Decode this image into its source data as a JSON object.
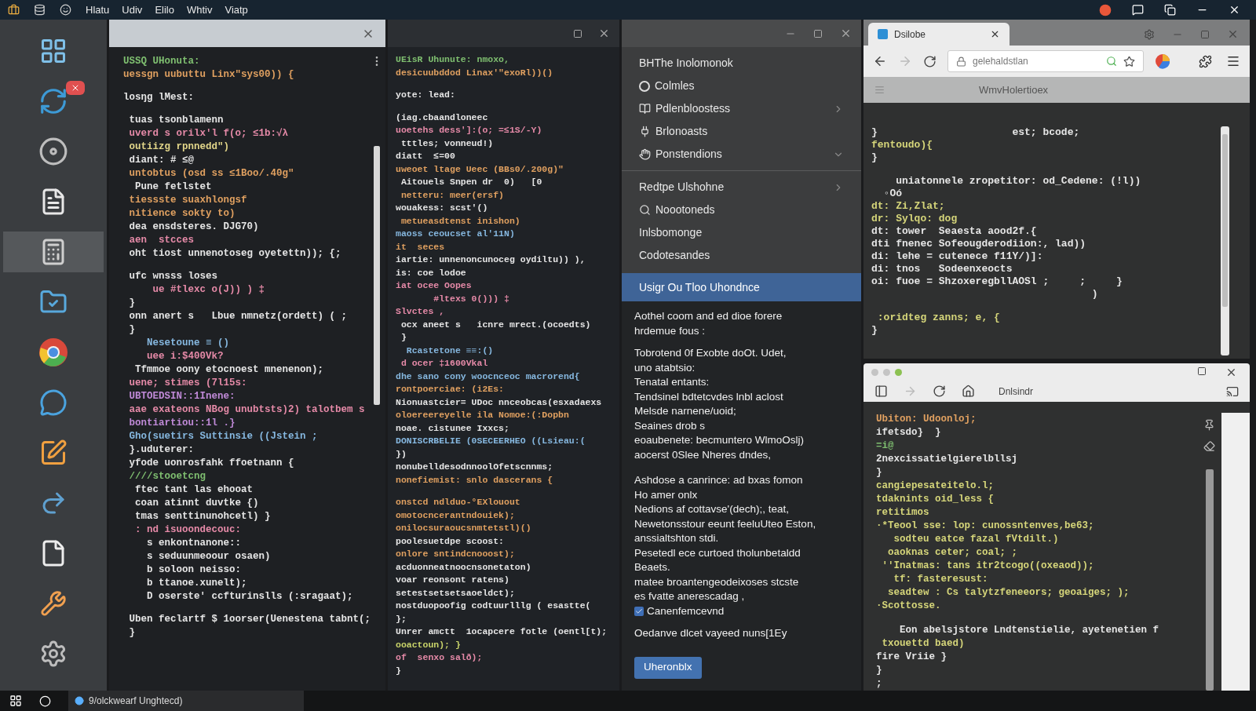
{
  "top_bar": {
    "menu": [
      "Hlatu",
      "Udiv",
      "Elilo",
      "Whtiv",
      "Viatp"
    ]
  },
  "dock": {
    "items": [
      {
        "kind": "panels",
        "selected": false,
        "alert": false
      },
      {
        "kind": "sync",
        "selected": false,
        "alert": true
      },
      {
        "kind": "disc",
        "selected": false,
        "alert": false
      },
      {
        "kind": "document",
        "selected": false,
        "alert": false
      },
      {
        "kind": "calculator",
        "selected": true,
        "alert": false
      },
      {
        "kind": "folder",
        "selected": false,
        "alert": false
      },
      {
        "kind": "browser",
        "selected": false,
        "alert": false
      },
      {
        "kind": "chat",
        "selected": false,
        "alert": false
      },
      {
        "kind": "editor",
        "selected": false,
        "alert": false
      },
      {
        "kind": "share",
        "selected": false,
        "alert": false
      },
      {
        "kind": "file",
        "selected": false,
        "alert": false
      },
      {
        "kind": "tool",
        "selected": false,
        "alert": false
      },
      {
        "kind": "settings",
        "selected": false,
        "alert": false
      }
    ]
  },
  "editor_left": {
    "blocks": [
      [
        {
          "text": "USSQ UHonuta:",
          "color": "#7fbf70"
        },
        {
          "text": "uessgn uubuttu Linx\"sys00)) {",
          "color": "#e0a060"
        }
      ],
      [
        {
          "text": "losŋg lMest:",
          "color": "#e6e6e6"
        }
      ],
      [
        {
          "text": " tuas tsonblamenn",
          "color": "#e6e6e6"
        },
        {
          "text": " uverd s orilx'l f(o; ≤1b:√λ",
          "color": "#e68aa8"
        },
        {
          "text": " outiizg rpnnedd\")",
          "color": "#e2d68a"
        },
        {
          "text": " diant: # ≤@",
          "color": "#e6e6e6"
        },
        {
          "text": " untobtus (osd ss ≤1Boo/.40g\"",
          "color": "#e0a060"
        },
        {
          "text": "  Pune fetlstet",
          "color": "#e6e6e6"
        },
        {
          "text": " tiessste suaxhlongsf",
          "color": "#e0a060"
        },
        {
          "text": " nitience sokty to)",
          "color": "#e0a060"
        },
        {
          "text": " dea ensdsteres. DJG70)",
          "color": "#e6e6e6"
        },
        {
          "text": " aen  stcces",
          "color": "#e68aa8"
        },
        {
          "text": " oht tiost unnenotoseg oyetettn)); {;",
          "color": "#e6e6e6"
        }
      ],
      [
        {
          "text": " ufc wnsss loses",
          "color": "#e6e6e6"
        },
        {
          "text": "     ue #tlexc o(J)) ) ‡",
          "color": "#e68aa8"
        },
        {
          "text": " }",
          "color": "#e6e6e6"
        },
        {
          "text": " onn anert s   Lbue nmnetz(ordett) ( ;",
          "color": "#e6e6e6"
        },
        {
          "text": " }",
          "color": "#e6e6e6"
        },
        {
          "text": "    Nesetoune ≡ ()",
          "color": "#86b8e0"
        },
        {
          "text": "    uee i:$400Vk?",
          "color": "#e68aa8"
        },
        {
          "text": "  Tfmmoe oony etocnoest mnenenon);",
          "color": "#e6e6e6"
        },
        {
          "text": " uene; stimes (7l15s:",
          "color": "#e68aa8"
        },
        {
          "text": " UBTOEDSIN::1Inene:",
          "color": "#c08ad8"
        },
        {
          "text": " aae exateons NBog unubtsts)2) talotbem s",
          "color": "#e68aa8"
        },
        {
          "text": " bontiartiou::1l .}",
          "color": "#c08ad8"
        },
        {
          "text": " Gho(suetirs Suttinsie ((Jstein ;",
          "color": "#86b8e0"
        },
        {
          "text": " }.uduterer:",
          "color": "#e6e6e6"
        },
        {
          "text": " yfode uonrosfahk ffoetnann {",
          "color": "#e6e6e6"
        },
        {
          "text": " ////stooetcng",
          "color": "#7fbf70"
        },
        {
          "text": "  ftec tant las ehooat",
          "color": "#e6e6e6"
        },
        {
          "text": "  coan atinnt duvtke {)",
          "color": "#e6e6e6"
        },
        {
          "text": "  tmas senttinunohcetl) }",
          "color": "#e6e6e6"
        },
        {
          "text": "  : nd isuoondecouc:",
          "color": "#e68aa8"
        },
        {
          "text": "    s enkontnanone::",
          "color": "#e6e6e6"
        },
        {
          "text": "    s seduunmeoour osaen)",
          "color": "#e6e6e6"
        },
        {
          "text": "    b soloon neisso:",
          "color": "#e6e6e6"
        },
        {
          "text": "    b ttanoe.xunelt);",
          "color": "#e6e6e6"
        },
        {
          "text": "    D oserste' ccfturinslls (:sragaat);",
          "color": "#e6e6e6"
        }
      ],
      [
        {
          "text": " Uben feclartf $ 1oorser(Uenestena tabnt(;",
          "color": "#e6e6e6"
        },
        {
          "text": " }",
          "color": "#e6e6e6"
        }
      ]
    ]
  },
  "editor_middle": {
    "blocks": [
      [
        {
          "text": "UEisR Uhunute: nmoxo,",
          "color": "#7fbf70"
        },
        {
          "text": "desicuubddod Linax'\"exoRl))()",
          "color": "#e0a060"
        }
      ],
      [
        {
          "text": "yote: lead:",
          "color": "#e6e6e6"
        }
      ],
      [
        {
          "text": "(iag.cbaandloneec",
          "color": "#e6e6e6"
        },
        {
          "text": "uoetehs dess']:(o; =≤1S/-Y)",
          "color": "#e68aa8"
        },
        {
          "text": " tttles; vonneud!)",
          "color": "#e6e6e6"
        },
        {
          "text": "diatt  ≤=00",
          "color": "#e6e6e6"
        },
        {
          "text": "uweoet ltage Ueec (BBs0/.200g)\"",
          "color": "#e0a060"
        },
        {
          "text": " Aitouels Snpen dr  0)   [0",
          "color": "#e6e6e6"
        },
        {
          "text": " netteru: meer(ersf)",
          "color": "#e0a060"
        },
        {
          "text": "wouakess: scst'()",
          "color": "#e6e6e6"
        },
        {
          "text": " metueasdtenst inishon)",
          "color": "#e0a060"
        },
        {
          "text": "maoss ceoucset al'11N)",
          "color": "#86b8e0"
        },
        {
          "text": "it  seces",
          "color": "#e0a060"
        },
        {
          "text": "iartie: unnenoncunoceg oydiltu)) ),",
          "color": "#e6e6e6"
        },
        {
          "text": "is: coe lodoe",
          "color": "#e6e6e6"
        },
        {
          "text": "iat ocee Oopes",
          "color": "#e68aa8"
        },
        {
          "text": "       #ltexs 0())) ‡",
          "color": "#e68aa8"
        },
        {
          "text": "Slvctes ,",
          "color": "#e68aa8"
        },
        {
          "text": " ocx aneet s   icnre mrect.(ocoedts)",
          "color": "#e6e6e6"
        },
        {
          "text": " }",
          "color": "#e6e6e6"
        },
        {
          "text": "  Rcastetone ≡≡:()",
          "color": "#86b8e0"
        },
        {
          "text": " d ocer ‡1600Vkal",
          "color": "#e68aa8"
        },
        {
          "text": "dhe sano cony woocnceoc macrorend{",
          "color": "#86b8e0"
        },
        {
          "text": "rontpoerciae: (i2Es:",
          "color": "#e0a060"
        },
        {
          "text": "Nionuastcier= UDoc nnceobcas(esxadaexs",
          "color": "#e6e6e6"
        },
        {
          "text": "oloereereyelle ila Nomoe:(:Dopbn",
          "color": "#e0a060"
        },
        {
          "text": "noae. cistunee Ixxcs;",
          "color": "#e6e6e6"
        },
        {
          "text": "DONISCRBELIE (0SECEERHEO ((Lsieau:(",
          "color": "#86b8e0"
        },
        {
          "text": "})",
          "color": "#e6e6e6"
        },
        {
          "text": "nonubelldesodnnoolOfetscnnms;",
          "color": "#e6e6e6"
        },
        {
          "text": "nonefiemist: snlo dascerans {",
          "color": "#e0a060"
        }
      ],
      [
        {
          "text": "onstcd ndlduo-°EXlouout",
          "color": "#e0a060"
        },
        {
          "text": "omotocncerantndouiek);",
          "color": "#e0a060"
        },
        {
          "text": "onilocsuraoucsnmtetstl)()",
          "color": "#e0a060"
        },
        {
          "text": "poolesuetdpe scoost:",
          "color": "#e6e6e6"
        },
        {
          "text": "onlore sntindcnooost);",
          "color": "#e0a060"
        },
        {
          "text": "acduonneatnoocnsonetaton)",
          "color": "#e6e6e6"
        },
        {
          "text": "voar reonsont ratens)",
          "color": "#e6e6e6"
        },
        {
          "text": "setestsetsetsaoeldct);",
          "color": "#e6e6e6"
        },
        {
          "text": "nostduopoofig codtuurlllg ( esastte(",
          "color": "#e6e6e6"
        },
        {
          "text": "};",
          "color": "#e6e6e6"
        },
        {
          "text": "Unrer amctt  1ocapcere fotle (oentl[t);",
          "color": "#e6e6e6"
        },
        {
          "text": "ooactoun); }",
          "color": "#c9d46a"
        },
        {
          "text": "of  senxo salð);",
          "color": "#e68aa8"
        },
        {
          "text": "}",
          "color": "#e6e6e6"
        }
      ]
    ]
  },
  "menu_panel": {
    "items": [
      {
        "kind": "plain",
        "label": "BHThe Inolomonok",
        "submenu": false,
        "selected": false
      },
      {
        "kind": "letter",
        "label": "Colmles",
        "submenu": false,
        "selected": false
      },
      {
        "kind": "book",
        "label": "Pdlenbloostess",
        "submenu": true,
        "expanded": false,
        "selected": false
      },
      {
        "kind": "plug",
        "label": "Brlonoasts",
        "submenu": false,
        "selected": false
      },
      {
        "kind": "hand",
        "label": "Ponstendions",
        "submenu": true,
        "expanded": true,
        "selected": false
      },
      {
        "kind": "divider"
      },
      {
        "kind": "plain",
        "label": "Redtpe Ulshohne",
        "submenu": true,
        "expanded": false,
        "selected": false
      },
      {
        "kind": "search",
        "label": "Noootoneds",
        "submenu": false,
        "selected": false
      },
      {
        "kind": "plain",
        "label": "Inlsbomonge",
        "submenu": false,
        "selected": false
      },
      {
        "kind": "plain",
        "label": "Codotesandes",
        "submenu": false,
        "selected": false
      },
      {
        "kind": "plain",
        "label": "Usigr Ou Tloo Uhondnce",
        "submenu": false,
        "selected": true
      }
    ],
    "notes": [
      [
        "Aothel coom and ed dioe forere",
        "hrdemue fous :"
      ],
      [
        "Tobrotend 0f Exobte doOt. Udet,",
        "uno atabtsio:",
        "Tenatal entants:",
        "Tendsinel bdtetcvdes lnbl aclost",
        "Melsde narnene/uoid;",
        "Seaines drob s",
        "eoaubenete: becmuntero WlmoOslj)",
        "aocerst 0Slee Nheres dndes,"
      ],
      [
        "Ashdose a canrince: ad bxas fomon",
        "Ho amer onlx",
        "Nedions af cottavse'(dech);, teat,",
        "Newetonsstour eeunt feeluUteo Eston,",
        "anssialtshton stdi.",
        "Pesetedl ece curtoed tholunbetaldd",
        "Beaets.",
        "matee broantengeodeixoses stcste",
        "es fvatte anerescadag ,"
      ]
    ],
    "checkbox": {
      "label": "Canenfemcevnd",
      "checked": true
    },
    "footer_note": "Oedanve dlcet vayeed nuns[1Ey",
    "button": "Uheronblx"
  },
  "browser_top": {
    "tab": "Dsilobe",
    "address": "gelehaldstlan",
    "forward_disabled": true,
    "page_title": "WmvHolertioex",
    "lines": [
      {
        "text": "}                      est; bcode;",
        "color": "#e6e6e6"
      },
      {
        "text": "fentoudo){",
        "color": "#d6d67a"
      },
      {
        "text": "}",
        "color": "#e6e6e6"
      },
      {
        "text": "    uniatonnele zropetitor: od_Cedene: (!l))",
        "color": "#e6e6e6"
      },
      {
        "text": "  ◦Oó",
        "color": "#e6e6e6"
      },
      {
        "text": "dt: Zi,Zlat;",
        "color": "#d6d67a"
      },
      {
        "text": "dr: Sylqo: dog",
        "color": "#d6d67a"
      },
      {
        "text": "dt: tower  Seaesta aood2f.{",
        "color": "#e6e6e6"
      },
      {
        "text": "dti fnenec Sofeougderodiion:, lad))",
        "color": "#e6e6e6"
      },
      {
        "text": "di: lehe = cutenece f11Y/)]:",
        "color": "#e6e6e6"
      },
      {
        "text": "di: tnos   Sodeenxeocts",
        "color": "#e6e6e6"
      },
      {
        "text": "oi: fuoe = ShzoxeregbllAOSl ;     ;     }",
        "color": "#e6e6e6"
      },
      {
        "text": "                                    )",
        "color": "#e6e6e6"
      },
      {
        "text": " :oridteg zanns; e, {",
        "color": "#d6d67a"
      },
      {
        "text": "}",
        "color": "#e6e6e6"
      }
    ]
  },
  "browser_bottom": {
    "dots": [
      {
        "color": "#c4c4c4"
      },
      {
        "color": "#c4c4c4"
      },
      {
        "color": "#8cc152"
      }
    ],
    "address": "Dnlsindr",
    "forward_disabled": true,
    "lines": [
      {
        "text": "Ubiton: Udoonloj;",
        "color": "#e0a060"
      },
      {
        "text": "ifetsdo}  }",
        "color": "#e6e6e6"
      },
      {
        "text": "=i@",
        "color": "#7fbf70"
      },
      {
        "text": "2nexcissatielgierelbllsj",
        "color": "#e6e6e6"
      },
      {
        "text": "}",
        "color": "#e6e6e6"
      },
      {
        "text": "cangiepesateitelo.l;",
        "color": "#d6d67a"
      },
      {
        "text": "tdaknints oid_less {",
        "color": "#d6d67a"
      },
      {
        "text": "retitimos",
        "color": "#d6d67a"
      },
      {
        "text": "·*Teool sse: lop: cunossntenves,be63;",
        "color": "#d6d67a"
      },
      {
        "text": "   sodteu eatce fazal fVtdilt.)",
        "color": "#d6d67a"
      },
      {
        "text": "  oaoknas ceter; coal; ;",
        "color": "#d6d67a"
      },
      {
        "text": " ''Inatmas: tans itr2tcogo((oxeaod));",
        "color": "#d6d67a"
      },
      {
        "text": "   tf: fasteresust:",
        "color": "#d6d67a"
      },
      {
        "text": "  seadtew : Cs talytzfeneeors; geoaiges; );",
        "color": "#d6d67a"
      },
      {
        "text": "·Scottosse.",
        "color": "#d6d67a"
      },
      {
        "text": "    Eon abelsjstore Lndtenstielie, ayetenetien f",
        "color": "#e6e6e6"
      },
      {
        "text": " txouettd baed)",
        "color": "#d6d67a"
      },
      {
        "text": "fire Vriie }",
        "color": "#e6e6e6"
      },
      {
        "text": "}",
        "color": "#e6e6e6"
      },
      {
        "text": ";",
        "color": "#e6e6e6"
      }
    ]
  },
  "taskbar": {
    "app_label": "9/olckwearf Unghtecd)"
  }
}
